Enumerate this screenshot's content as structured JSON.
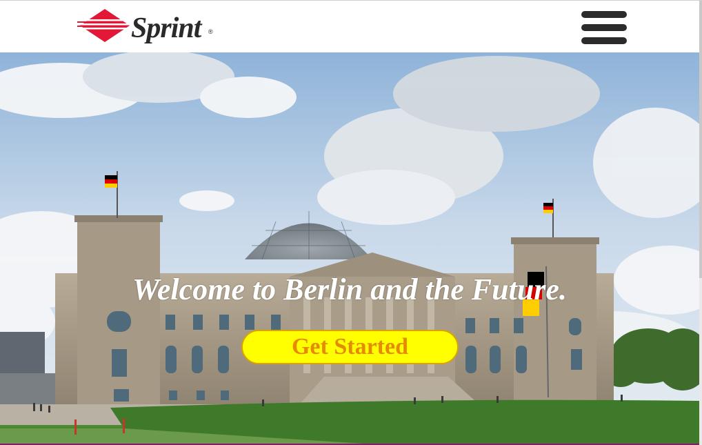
{
  "brand": {
    "name": "Sprint",
    "registered_mark": "®",
    "logo_icon": "sprint-diamond-logo",
    "colors": {
      "red": "#e31837",
      "dark": "#2a2a2a"
    }
  },
  "header": {
    "menu_icon": "hamburger-menu-icon"
  },
  "hero": {
    "background_image": "reichstag-building-berlin",
    "title": "Welcome to Berlin and the Future.",
    "cta_label": "Get Started",
    "colors": {
      "cta_bg": "#ffff00",
      "cta_text": "#e68a00",
      "title": "#ffffff"
    }
  }
}
